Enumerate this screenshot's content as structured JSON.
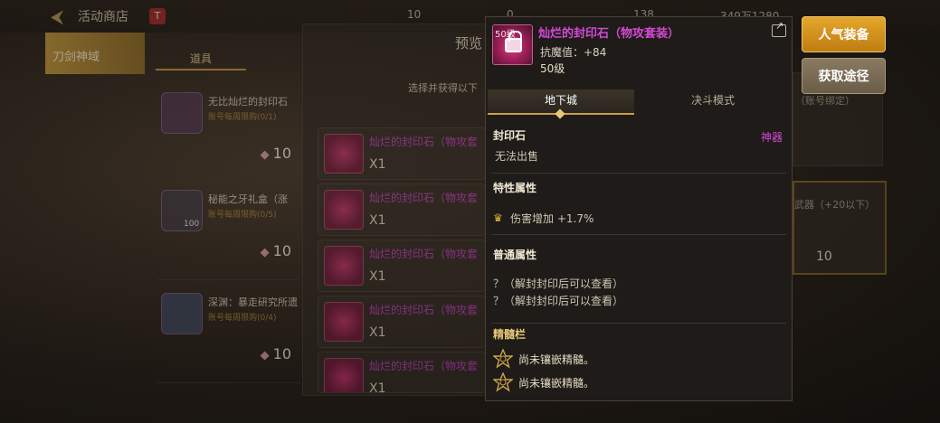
{
  "topbar": {
    "title": "活动商店",
    "badge": "T",
    "currency1": "10",
    "currency2": "0",
    "currency3": "138",
    "currency4": "349万1280"
  },
  "sidebar": {
    "active_tab": "刀剑神域"
  },
  "subtabs": {
    "active": "道具"
  },
  "shop_items": [
    {
      "name": "无比灿烂的封印石",
      "sub": "账号每周限购(0/1)",
      "price": "10"
    },
    {
      "name": "秘能之牙礼盒（涨",
      "sub": "账号每周限购(0/5)",
      "price": "10",
      "count": "100"
    },
    {
      "name": "深渊：暴走研究所遗",
      "sub": "账号每周限购(0/4)",
      "price": "10"
    }
  ],
  "preview": {
    "title": "预览",
    "hint": "选择并获得以下",
    "items": [
      {
        "name": "灿烂的封印石（物攻套",
        "qty": "X1"
      },
      {
        "name": "灿烂的封印石（物攻套",
        "qty": "X1"
      },
      {
        "name": "灿烂的封印石（物攻套",
        "qty": "X1"
      },
      {
        "name": "灿烂的封印石（物攻套",
        "qty": "X1"
      },
      {
        "name": "灿烂的封印石（物攻套",
        "qty": "X1"
      }
    ]
  },
  "right_panel": {
    "note": "（账号绑定）",
    "item_text": "武器（+20以下）",
    "price": "10"
  },
  "buttons": {
    "popular": "人气装备",
    "source": "获取途径"
  },
  "tooltip": {
    "level_badge": "50级",
    "name": "灿烂的封印石（物攻套装）",
    "stat": "抗魔值：+84",
    "level": "50级",
    "tabs": [
      "地下城",
      "决斗模式"
    ],
    "category": "封印石",
    "tag": "神器",
    "sell": "无法出售",
    "special_title": "特性属性",
    "special_attr": "伤害增加 +1.7%",
    "normal_title": "普通属性",
    "normal_attrs": [
      "？（解封封印后可以查看）",
      "？（解封封印后可以查看）"
    ],
    "essence_title": "精髓栏",
    "essence_slots": [
      "尚未镶嵌精髓。",
      "尚未镶嵌精髓。"
    ]
  }
}
